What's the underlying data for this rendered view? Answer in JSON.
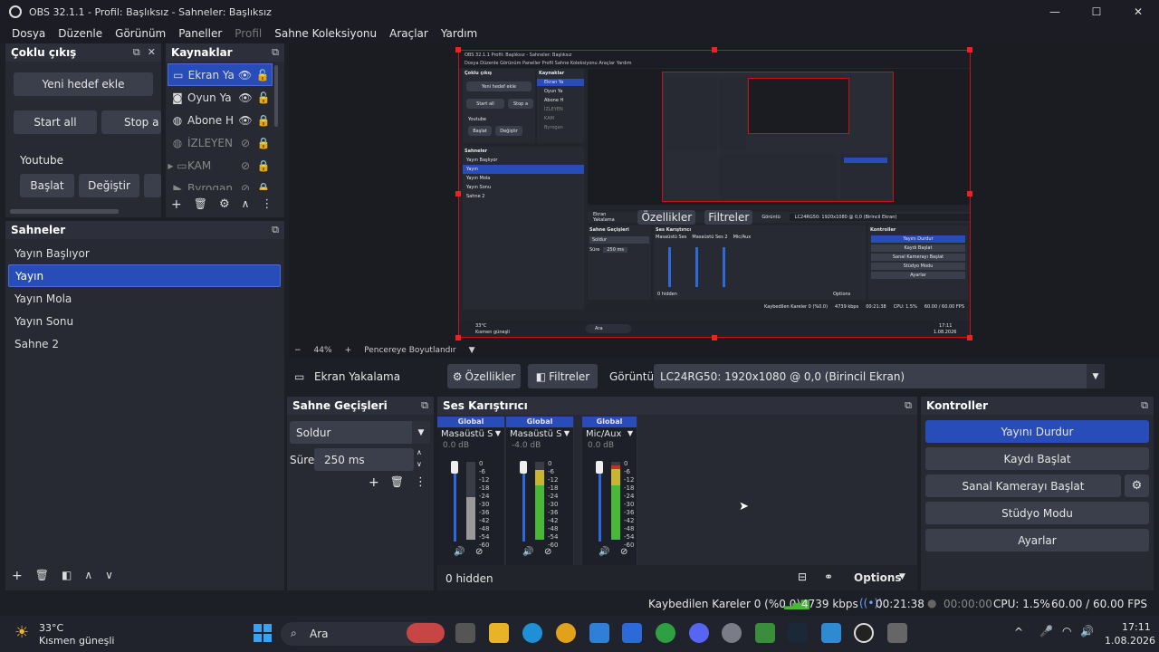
{
  "window": {
    "title": "OBS 32.1.1 - Profil: Başlıksız - Sahneler: Başlıksız",
    "minimize": "—",
    "maximize": "☐",
    "close": "✕"
  },
  "menu": [
    "Dosya",
    "Düzenle",
    "Görünüm",
    "Paneller",
    "Profil",
    "Araçlar",
    "Yardım",
    "Sahne Koleksiyonu"
  ],
  "menu_items": [
    {
      "label": "Dosya",
      "dim": false
    },
    {
      "label": "Düzenle",
      "dim": false
    },
    {
      "label": "Görünüm",
      "dim": false
    },
    {
      "label": "Paneller",
      "dim": false
    },
    {
      "label": "Profil",
      "dim": true
    },
    {
      "label": "Sahne Koleksiyonu",
      "dim": false
    },
    {
      "label": "Araçlar",
      "dim": false
    },
    {
      "label": "Yardım",
      "dim": false
    }
  ],
  "multi_output": {
    "title": "Çoklu çıkış",
    "new_target": "Yeni hedef ekle",
    "start_all": "Start all",
    "stop_all": "Stop a",
    "target_name": "Youtube",
    "start": "Başlat",
    "change": "Değiştir"
  },
  "sources": {
    "title": "Kaynaklar",
    "items": [
      {
        "label": "Ekran Ya",
        "icon": "monitor-icon",
        "glyph": "▭",
        "eye": "👁",
        "lock": "🔓",
        "selected": true,
        "dim": false
      },
      {
        "label": "Oyun Ya",
        "icon": "gamepad-icon",
        "glyph": "◙",
        "eye": "👁",
        "lock": "🔓",
        "selected": false,
        "dim": false
      },
      {
        "label": "Abone H",
        "icon": "globe-icon",
        "glyph": "◍",
        "eye": "👁",
        "lock": "🔒",
        "selected": false,
        "dim": false
      },
      {
        "label": "İZLEYEN",
        "icon": "globe-icon",
        "glyph": "◍",
        "eye": "⊘",
        "lock": "🔒",
        "selected": false,
        "dim": true
      },
      {
        "label": "KAM",
        "icon": "folder-icon",
        "glyph": "▸ ▭",
        "eye": "⊘",
        "lock": "🔒",
        "selected": false,
        "dim": true
      },
      {
        "label": "Byrogan",
        "icon": "play-icon",
        "glyph": "▶",
        "eye": "⊘",
        "lock": "🔒",
        "selected": false,
        "dim": true
      }
    ]
  },
  "scenes": {
    "title": "Sahneler",
    "items": [
      {
        "label": "Yayın Başlıyor",
        "selected": false
      },
      {
        "label": "Yayın",
        "selected": true
      },
      {
        "label": "Yayın Mola",
        "selected": false
      },
      {
        "label": "Yayın Sonu",
        "selected": false
      },
      {
        "label": "Sahne 2",
        "selected": false
      }
    ]
  },
  "preview_toolbar": {
    "minus": "−",
    "zoom": "44%",
    "plus": "+",
    "fit": "Pencereye Boyutlandır"
  },
  "source_bar": {
    "source_name": "Ekran Yakalama",
    "properties": "Özellikler",
    "filters": "Filtreler",
    "display_label": "Görüntü",
    "display_value": "LC24RG50: 1920x1080 @ 0,0 (Birincil Ekran)"
  },
  "transitions": {
    "title": "Sahne Geçişleri",
    "type": "Soldur",
    "duration_label": "Süre",
    "duration": "250 ms"
  },
  "mixer": {
    "title": "Ses Karıştırıcı",
    "channels": [
      {
        "tag": "Global",
        "name": "Masaüstü Ses",
        "db": "0.0 dB",
        "muted": true,
        "level": 0.55
      },
      {
        "tag": "Global",
        "name": "Masaüstü Ses 2",
        "db": "-4.0 dB",
        "muted": false,
        "level": 0.9
      },
      {
        "tag": "Global",
        "name": "Mic/Aux",
        "db": "0.0 dB",
        "muted": false,
        "level": 0.95
      }
    ],
    "scale": [
      "0",
      "-6",
      "-12",
      "-18",
      "-24",
      "-30",
      "-36",
      "-42",
      "-48",
      "-54",
      "-60"
    ],
    "hidden": "0 hidden",
    "options": "Options"
  },
  "controls": {
    "title": "Kontroller",
    "stop_stream": "Yayını Durdur",
    "start_record": "Kaydı Başlat",
    "virtual_cam": "Sanal Kamerayı Başlat",
    "studio_mode": "Stüdyo Modu",
    "settings": "Ayarlar"
  },
  "status": {
    "dropped": "Kaybedilen Kareler 0 (%0.0)",
    "bitrate": "4739 kbps",
    "stream_time": "00:21:38",
    "record_time": "00:00:00",
    "cpu": "CPU: 1.5%",
    "fps": "60.00 / 60.00 FPS"
  },
  "taskbar": {
    "temp": "33°C",
    "weather": "Kısmen güneşli",
    "search": "Ara",
    "time": "17:11",
    "date": "1.08.2026",
    "tray_up": "^"
  },
  "mini": {
    "title": "OBS 32.1.1  Profil: Başlıksız - Sahneler: Başlıksız",
    "menu": "Dosya  Düzenle  Görünüm  Paneller  Profil  Sahne Koleksiyonu  Araçlar  Yardım",
    "multi": "Çoklu çıkış",
    "new_target": "Yeni hedef ekle",
    "start_all": "Start all",
    "stop": "Stop a",
    "youtube": "Youtube",
    "start": "Başlat",
    "change": "Değiştir",
    "sources": "Kaynaklar",
    "src1": "Ekran Ya",
    "src2": "Oyun Ya",
    "src3": "Abone H",
    "src4": "İZLEYEN",
    "src5": "KAM",
    "src6": "Byrogan",
    "scenes": "Sahneler",
    "s1": "Yayın Başlıyor",
    "s2": "Yayın",
    "s3": "Yayın Mola",
    "s4": "Yayın Sonu",
    "s5": "Sahne 2",
    "source_name": "Ekran Yakalama",
    "props": "Özellikler",
    "filters": "Filtreler",
    "display_label": "Görüntü",
    "display": "LC24RG50: 1920x1080 @ 0,0 (Birincil Ekran)",
    "trans": "Sahne Geçişleri",
    "fade": "Soldur",
    "dur_label": "Süre",
    "dur": "250 ms",
    "mixer": "Ses Karıştırıcı",
    "ch1": "Masaüstü Ses",
    "ch2": "Masaüstü Ses 2",
    "ch3": "Mic/Aux",
    "global": "Global",
    "hidden": "0 hidden",
    "options": "Options",
    "controls": "Kontroller",
    "c1": "Yayını Durdur",
    "c2": "Kaydı Başlat",
    "c3": "Sanal Kamerayı Başlat",
    "c4": "Stüdyo Modu",
    "c5": "Ayarlar",
    "status_dropped": "Kaybedilen Kareler 0 (%0.0)",
    "status_kbps": "4739 kbps",
    "status_time": "00:21:38",
    "status_cpu": "CPU: 1.5%",
    "status_fps": "60.00 / 60.00 FPS",
    "tb_temp": "33°C",
    "tb_weather": "Kısmen güneşli",
    "tb_search": "Ara",
    "tb_time": "17:11",
    "tb_date": "1.08.2026"
  },
  "colors": {
    "accent": "#284cb8",
    "panel": "#272a33",
    "panel_header": "#2d303b",
    "button": "#3b3f4b",
    "selection_red": "#e22222",
    "meter_green": "#49b838",
    "meter_yellow": "#c9b630",
    "meter_red": "#c43030"
  }
}
